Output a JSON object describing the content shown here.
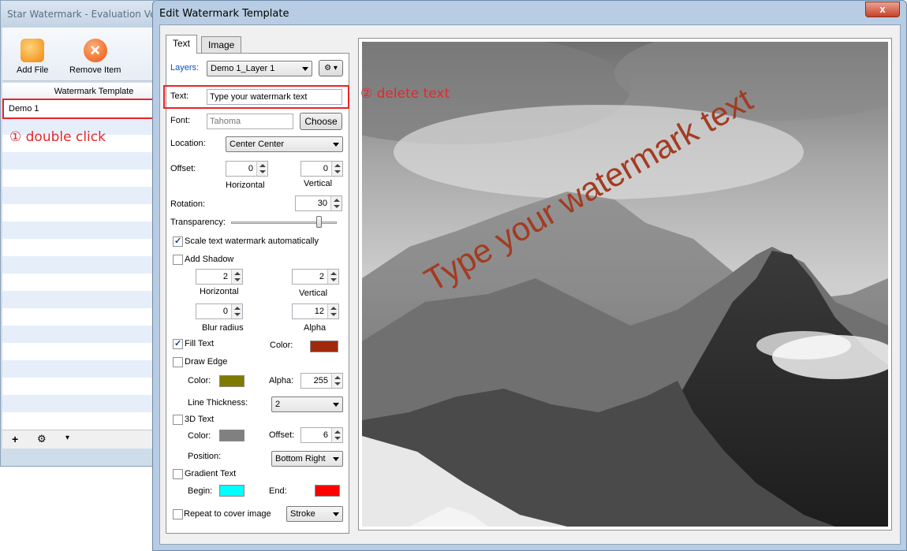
{
  "background_window": {
    "title": "Star Watermark - Evaluation Versi",
    "toolbar": {
      "add_file": "Add File",
      "remove_item": "Remove Item"
    },
    "list_header": "Watermark Template",
    "list_items": [
      "Demo 1"
    ],
    "bottom_buttons": {
      "add": "+",
      "settings": "⚙",
      "menu": "▾"
    }
  },
  "annotations": {
    "step1": "① double click",
    "step2": "② delete text"
  },
  "dialog": {
    "title": "Edit Watermark Template",
    "close": "x",
    "tabs": [
      "Text",
      "Image"
    ],
    "layers_label": "Layers:",
    "layers_value": "Demo 1_Layer 1",
    "gear_button": "⚙ ▾",
    "text_label": "Text:",
    "text_value": "Type your watermark text",
    "font_label": "Font:",
    "font_value": "Tahoma",
    "choose_button": "Choose",
    "location_label": "Location:",
    "location_value": "Center Center",
    "offset_label": "Offset:",
    "offset_h": "0",
    "offset_v": "0",
    "horizontal": "Horizontal",
    "vertical": "Vertical",
    "rotation_label": "Rotation:",
    "rotation_value": "30",
    "transparency_label": "Transparency:",
    "transparency_level": 0.83,
    "scale_label": "Scale text watermark automatically",
    "scale_checked": true,
    "shadow_label": "Add Shadow",
    "shadow_checked": false,
    "shadow_h": "2",
    "shadow_v": "2",
    "blur_label": "Blur radius",
    "blur_value": "0",
    "alpha_label": "Alpha",
    "alpha_value": "12",
    "fill_label": "Fill Text",
    "fill_checked": true,
    "color_label": "Color:",
    "fill_color": "#a0290c",
    "edge_label": "Draw Edge",
    "edge_checked": false,
    "edge_color": "#7f7a00",
    "edge_alpha_label": "Alpha:",
    "edge_alpha": "255",
    "thickness_label": "Line Thickness:",
    "thickness_value": "2",
    "text3d_label": "3D Text",
    "text3d_checked": false,
    "text3d_color": "#808080",
    "text3d_offset_label": "Offset:",
    "text3d_offset": "6",
    "position_label": "Position:",
    "position_value": "Bottom Right",
    "gradient_label": "Gradient Text",
    "gradient_checked": false,
    "begin_label": "Begin:",
    "begin_color": "#00ffff",
    "end_label": "End:",
    "end_color": "#ff0000",
    "repeat_label": "Repeat to cover image",
    "repeat_checked": false,
    "stroke_value": "Stroke"
  },
  "preview": {
    "watermark_text": "Type your watermark text",
    "watermark_color": "#a33b22"
  }
}
